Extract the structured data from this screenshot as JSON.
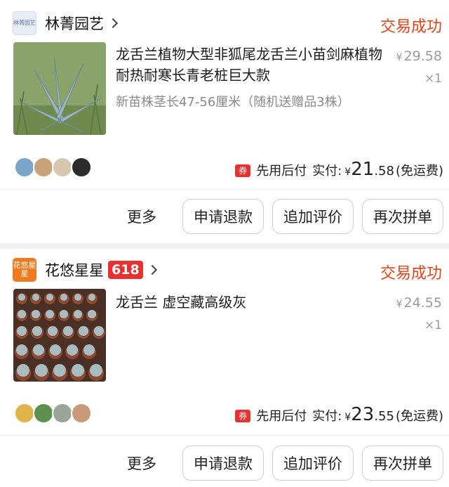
{
  "orders": [
    {
      "shop": {
        "name": "林菁园艺",
        "logo_text": "林菁园艺"
      },
      "status": "交易成功",
      "product": {
        "title": "龙舌兰植物大型非狐尾龙舌兰小苗剑麻植物耐热耐寒长青老桩巨大款",
        "spec": "新苗株茎长47-56厘米（随机送赠品3株）",
        "price_symbol": "¥",
        "price": "29.58",
        "qty": "×1"
      },
      "payment": {
        "coupon_icon": "券",
        "method": "先用后付",
        "paid_label": "实付:",
        "currency": "¥",
        "amount_int": "21",
        "amount_dec": ".58",
        "shipping": "(免运费)"
      },
      "actions": {
        "more": "更多",
        "refund": "申请退款",
        "review": "追加评价",
        "rebuy": "再次拼单"
      }
    },
    {
      "shop": {
        "name": "花悠星星",
        "logo_text": "花悠星星",
        "promo_badge": "618"
      },
      "status": "交易成功",
      "product": {
        "title": "龙舌兰 虚空藏高级灰",
        "spec": "",
        "price_symbol": "¥",
        "price": "24.55",
        "qty": "×1"
      },
      "payment": {
        "coupon_icon": "券",
        "method": "先用后付",
        "paid_label": "实付:",
        "currency": "¥",
        "amount_int": "23",
        "amount_dec": ".55",
        "shipping": "(免运费)"
      },
      "actions": {
        "more": "更多",
        "refund": "申请退款",
        "review": "追加评价",
        "rebuy": "再次拼单"
      }
    }
  ],
  "colors": {
    "status": "#e3421b",
    "badge": "#e8312f",
    "logo2": "#f07b1f"
  }
}
